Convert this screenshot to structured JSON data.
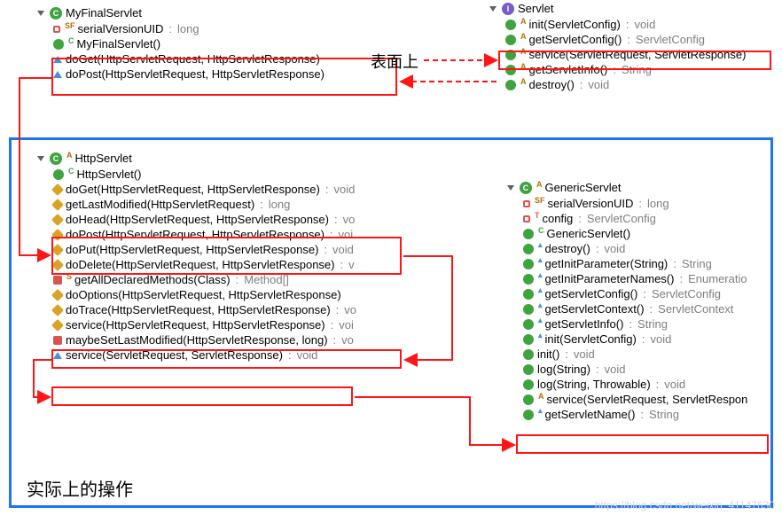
{
  "labels": {
    "surface": "表面上",
    "actual": "实际上的操作"
  },
  "watermark": "https://blog.csdn.net/weixin_41147630",
  "myFinalServlet": {
    "name": "MyFinalServlet",
    "items": [
      {
        "icon": "field-sf",
        "name": "serialVersionUID",
        "ret": "long"
      },
      {
        "icon": "public-c",
        "name": "MyFinalServlet()",
        "ret": ""
      },
      {
        "icon": "tri",
        "name": "doGet(HttpServletRequest, HttpServletResponse)",
        "ret": ""
      },
      {
        "icon": "tri",
        "name": "doPost(HttpServletRequest, HttpServletResponse)",
        "ret": ""
      }
    ]
  },
  "servlet": {
    "name": "Servlet",
    "items": [
      {
        "icon": "pub-a",
        "name": "init(ServletConfig)",
        "ret": "void"
      },
      {
        "icon": "pub-a",
        "name": "getServletConfig()",
        "ret": "ServletConfig"
      },
      {
        "icon": "pub-a",
        "name": "service(ServletRequest, ServletResponse)",
        "ret": ""
      },
      {
        "icon": "pub-a",
        "name": "getServletInfo()",
        "ret": "String"
      },
      {
        "icon": "pub-a",
        "name": "destroy()",
        "ret": "void"
      }
    ]
  },
  "httpServlet": {
    "name": "HttpServlet",
    "items": [
      {
        "icon": "public-c",
        "name": "HttpServlet()",
        "ret": ""
      },
      {
        "icon": "protected",
        "name": "doGet(HttpServletRequest, HttpServletResponse)",
        "ret": "void"
      },
      {
        "icon": "protected",
        "name": "getLastModified(HttpServletRequest)",
        "ret": "long"
      },
      {
        "icon": "protected",
        "name": "doHead(HttpServletRequest, HttpServletResponse)",
        "ret": "vo"
      },
      {
        "icon": "protected",
        "name": "doPost(HttpServletRequest, HttpServletResponse)",
        "ret": "voi"
      },
      {
        "icon": "protected",
        "name": "doPut(HttpServletRequest, HttpServletResponse)",
        "ret": "void"
      },
      {
        "icon": "protected",
        "name": "doDelete(HttpServletRequest, HttpServletResponse)",
        "ret": "v"
      },
      {
        "icon": "private-s",
        "name": "getAllDeclaredMethods(Class<?>)",
        "ret": "Method[]"
      },
      {
        "icon": "protected",
        "name": "doOptions(HttpServletRequest, HttpServletResponse)",
        "ret": ""
      },
      {
        "icon": "protected",
        "name": "doTrace(HttpServletRequest, HttpServletResponse)",
        "ret": "vo"
      },
      {
        "icon": "protected",
        "name": "service(HttpServletRequest, HttpServletResponse)",
        "ret": "voi"
      },
      {
        "icon": "private",
        "name": "maybeSetLastModified(HttpServletResponse, long)",
        "ret": "vo"
      },
      {
        "icon": "tri",
        "name": "service(ServletRequest, ServletResponse)",
        "ret": "void"
      }
    ]
  },
  "genericServlet": {
    "name": "GenericServlet",
    "items": [
      {
        "icon": "field-sf",
        "name": "serialVersionUID",
        "ret": "long"
      },
      {
        "icon": "field-t",
        "name": "config",
        "ret": "ServletConfig"
      },
      {
        "icon": "public-c",
        "name": "GenericServlet()",
        "ret": ""
      },
      {
        "icon": "pub-tri",
        "name": "destroy()",
        "ret": "void"
      },
      {
        "icon": "pub-tri",
        "name": "getInitParameter(String)",
        "ret": "String"
      },
      {
        "icon": "pub-tri",
        "name": "getInitParameterNames()",
        "ret": "Enumeratio"
      },
      {
        "icon": "pub-tri",
        "name": "getServletConfig()",
        "ret": "ServletConfig"
      },
      {
        "icon": "pub-tri",
        "name": "getServletContext()",
        "ret": "ServletContext"
      },
      {
        "icon": "pub-tri",
        "name": "getServletInfo()",
        "ret": "String"
      },
      {
        "icon": "pub-tri",
        "name": "init(ServletConfig)",
        "ret": "void"
      },
      {
        "icon": "public",
        "name": "init()",
        "ret": "void"
      },
      {
        "icon": "public",
        "name": "log(String)",
        "ret": "void"
      },
      {
        "icon": "public",
        "name": "log(String, Throwable)",
        "ret": "void"
      },
      {
        "icon": "pub-a",
        "name": "service(ServletRequest, ServletRespon",
        "ret": ""
      },
      {
        "icon": "pub-tri",
        "name": "getServletName()",
        "ret": "String"
      }
    ]
  }
}
